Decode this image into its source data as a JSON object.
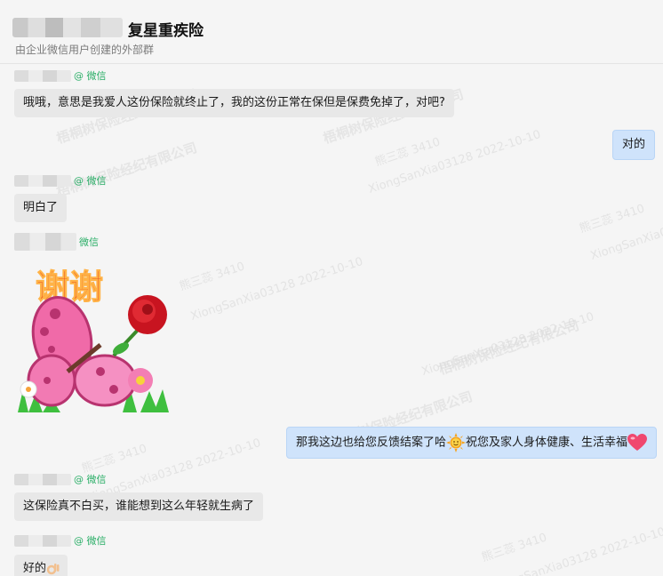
{
  "header": {
    "title": "复星重疾险",
    "subtitle": "由企业微信用户创建的外部群"
  },
  "sender_tag": "@ 微信",
  "sender_tag_short": "微信",
  "messages": {
    "m1": "哦哦，意思是我爱人这份保险就终止了，我的这份正常在保但是保费免掉了，对吧?",
    "m2": "对的",
    "m3": "明白了",
    "m4_sticker_text": "谢谢",
    "m5_part1": "那我这边也给您反馈结案了哈",
    "m5_part2": "祝您及家人身体健康、生活幸福",
    "m6": "这保险真不白买，谁能想到这么年轻就生病了",
    "m7": "好的"
  },
  "watermark": {
    "company": "梧桐树保险经纪有限公司",
    "user": "熊三蕊 3410",
    "id": "XiongSanXia03128 2022-10-10"
  },
  "colors": {
    "wechat_green": "#2aae67",
    "bubble_left": "#e8e8e8",
    "bubble_right": "#cfe3fb"
  }
}
